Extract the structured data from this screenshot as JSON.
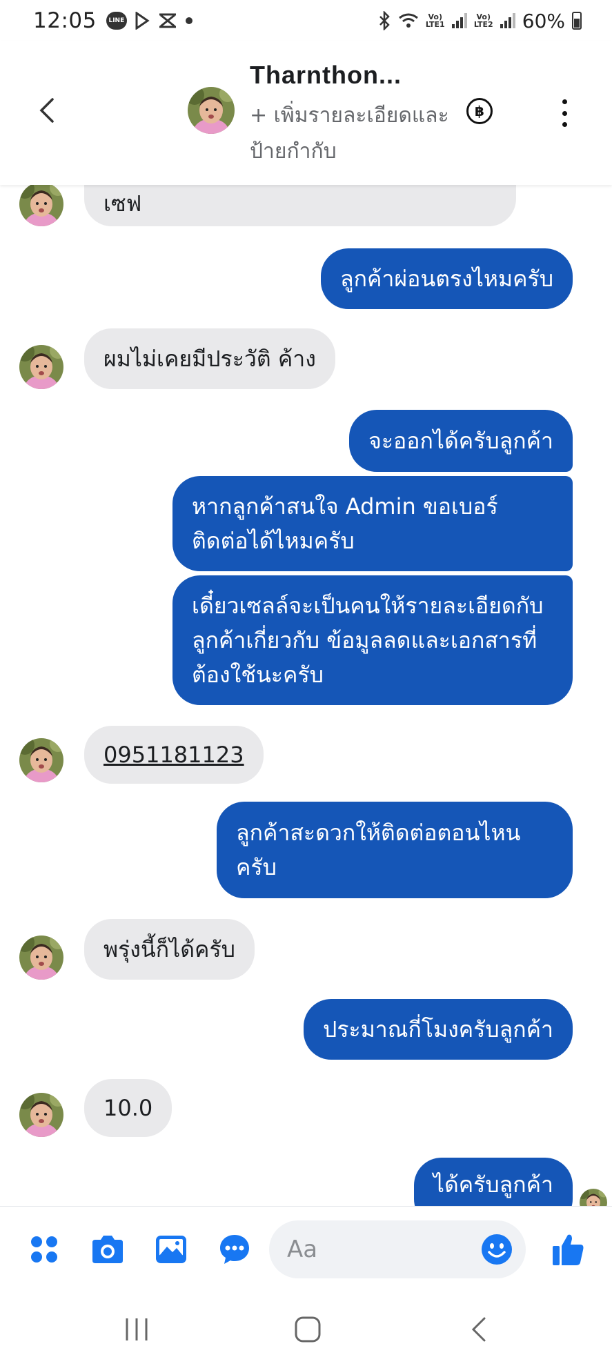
{
  "status_bar": {
    "time": "12:05",
    "line_label": "LINE",
    "sim1_label": "Vo) LTE1",
    "sim2_label": "Vo) LTE2",
    "battery": "60%"
  },
  "header": {
    "contact_name": "Tharnthon...",
    "subtitle": "+ เพิ่มรายละเอียดและป้ายกำกับ",
    "coin_symbol": "฿"
  },
  "messages": [
    {
      "side": "in",
      "text": "เซฟ"
    },
    {
      "side": "out",
      "text": "ลูกค้าผ่อนตรงไหมครับ"
    },
    {
      "side": "in",
      "text": "ผมไม่เคยมีประวัติ ค้าง"
    },
    {
      "side": "out",
      "text": "จะออกได้ครับลูกค้า"
    },
    {
      "side": "out",
      "text": "หากลูกค้าสนใจ Admin ขอเบอร์ติดต่อได้ไหมครับ"
    },
    {
      "side": "out",
      "text": "เดี๋ยวเซลล์จะเป็นคนให้รายละเอียดกับลูกค้าเกี่ยวกับ ข้อมูลลดและเอกสารที่ต้องใช้นะครับ"
    },
    {
      "side": "in",
      "text": "0951181123"
    },
    {
      "side": "out",
      "text": "ลูกค้าสะดวกให้ติดต่อตอนไหนครับ"
    },
    {
      "side": "in",
      "text": "พรุ่งนี้ก็ได้ครับ"
    },
    {
      "side": "out",
      "text": "ประมาณกี่โมงครับลูกค้า"
    },
    {
      "side": "in",
      "text": "10.0"
    },
    {
      "side": "out",
      "text": "ได้ครับลูกค้า"
    }
  ],
  "composer": {
    "placeholder": "Aa"
  },
  "icons": {
    "menu": "grid-dots-icon",
    "camera": "camera-icon",
    "gallery": "image-icon",
    "chat": "chat-bubble-icon",
    "emoji": "smiley-icon",
    "like": "thumbs-up-icon"
  },
  "colors": {
    "accent": "#1877f2",
    "outgoing_bubble": "#1556b7",
    "incoming_bubble": "#e9e9eb"
  }
}
